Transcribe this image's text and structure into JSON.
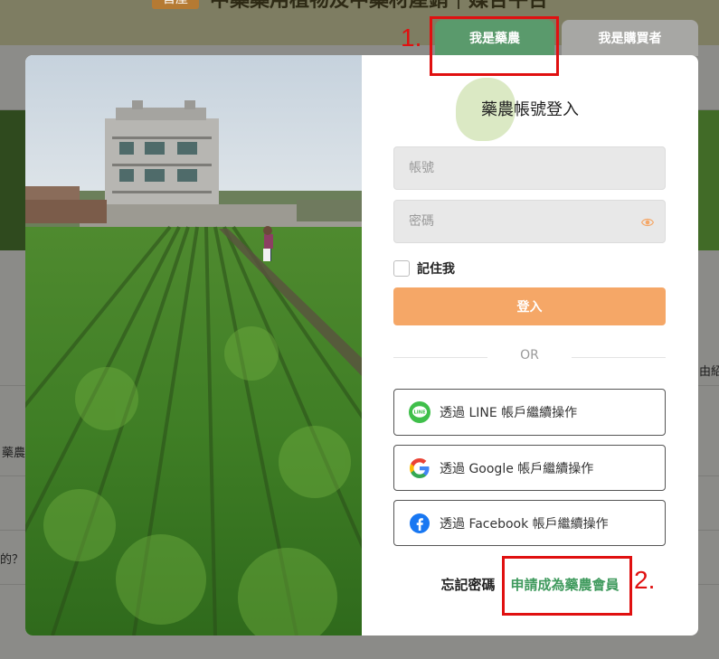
{
  "background": {
    "badge": "首屋",
    "title": "中藥藥用植物及中藥材產銷｜媒合平台",
    "snippet_right": "由紹",
    "snippet_left_1": "藥農",
    "snippet_left_2": "的？"
  },
  "tabs": [
    {
      "label": "我是藥農",
      "active": true
    },
    {
      "label": "我是購買者",
      "active": false
    }
  ],
  "login": {
    "title": "藥農帳號登入",
    "account_placeholder": "帳號",
    "password_placeholder": "密碼",
    "remember_label": "記住我",
    "submit_label": "登入",
    "divider": "OR"
  },
  "social": {
    "line_label": "透過 LINE 帳戶繼續操作",
    "google_label": "透過 Google 帳戶繼續操作",
    "facebook_label": "透過 Facebook 帳戶繼續操作",
    "line_icon_text": "LINE"
  },
  "links": {
    "forgot": "忘記密碼",
    "separator": "|",
    "register": "申請成為藥農會員"
  },
  "annotations": {
    "step1": "1.",
    "step2": "2."
  },
  "colors": {
    "primary_green": "#5a9a6c",
    "login_button": "#f5a767",
    "annotation_red": "#e01010"
  }
}
